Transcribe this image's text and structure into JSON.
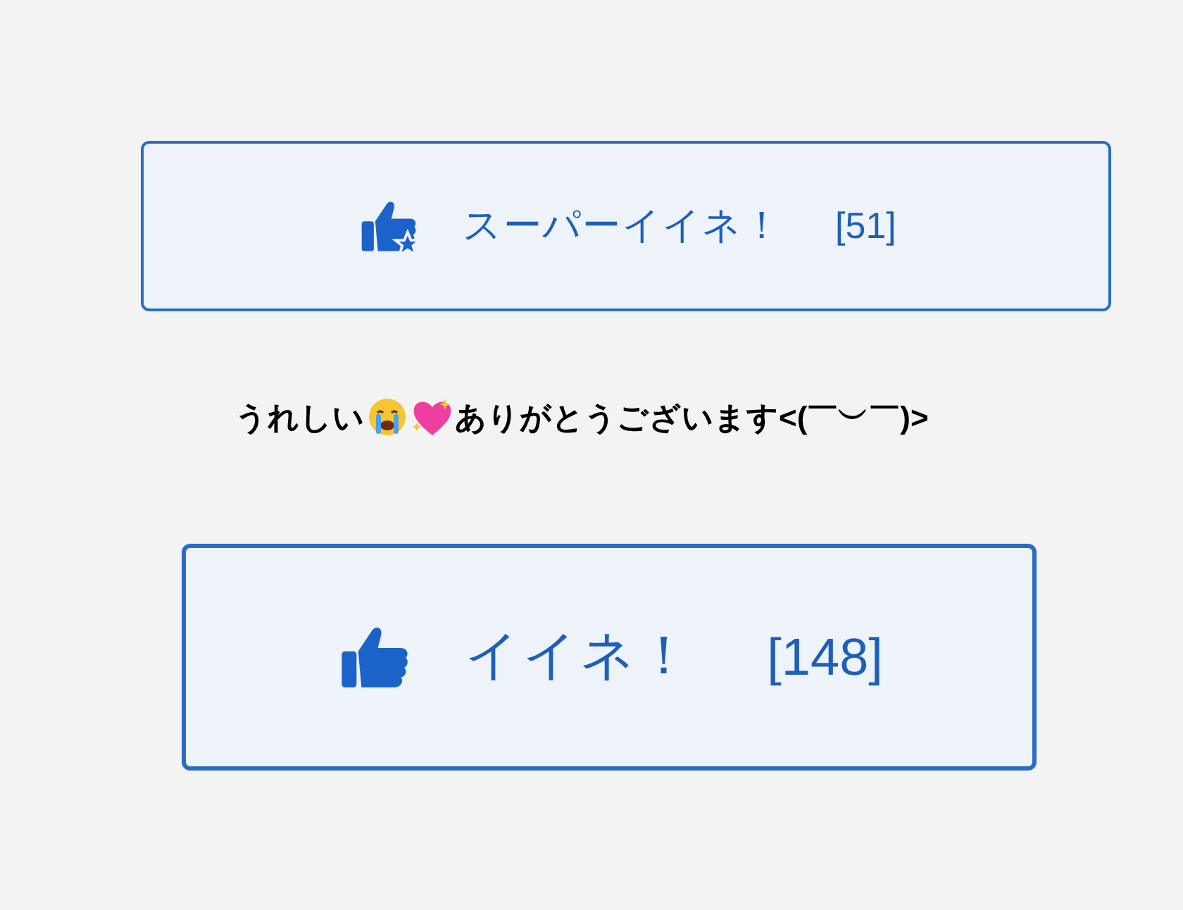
{
  "buttons": [
    {
      "kind": "super",
      "label": "スーパーイイネ！",
      "count": "[51]"
    },
    {
      "kind": "normal",
      "label": "イイネ！",
      "count": "[148]"
    }
  ],
  "message": {
    "before": "うれしい",
    "after": "ありがとうございます<(￣︶￣)>"
  }
}
